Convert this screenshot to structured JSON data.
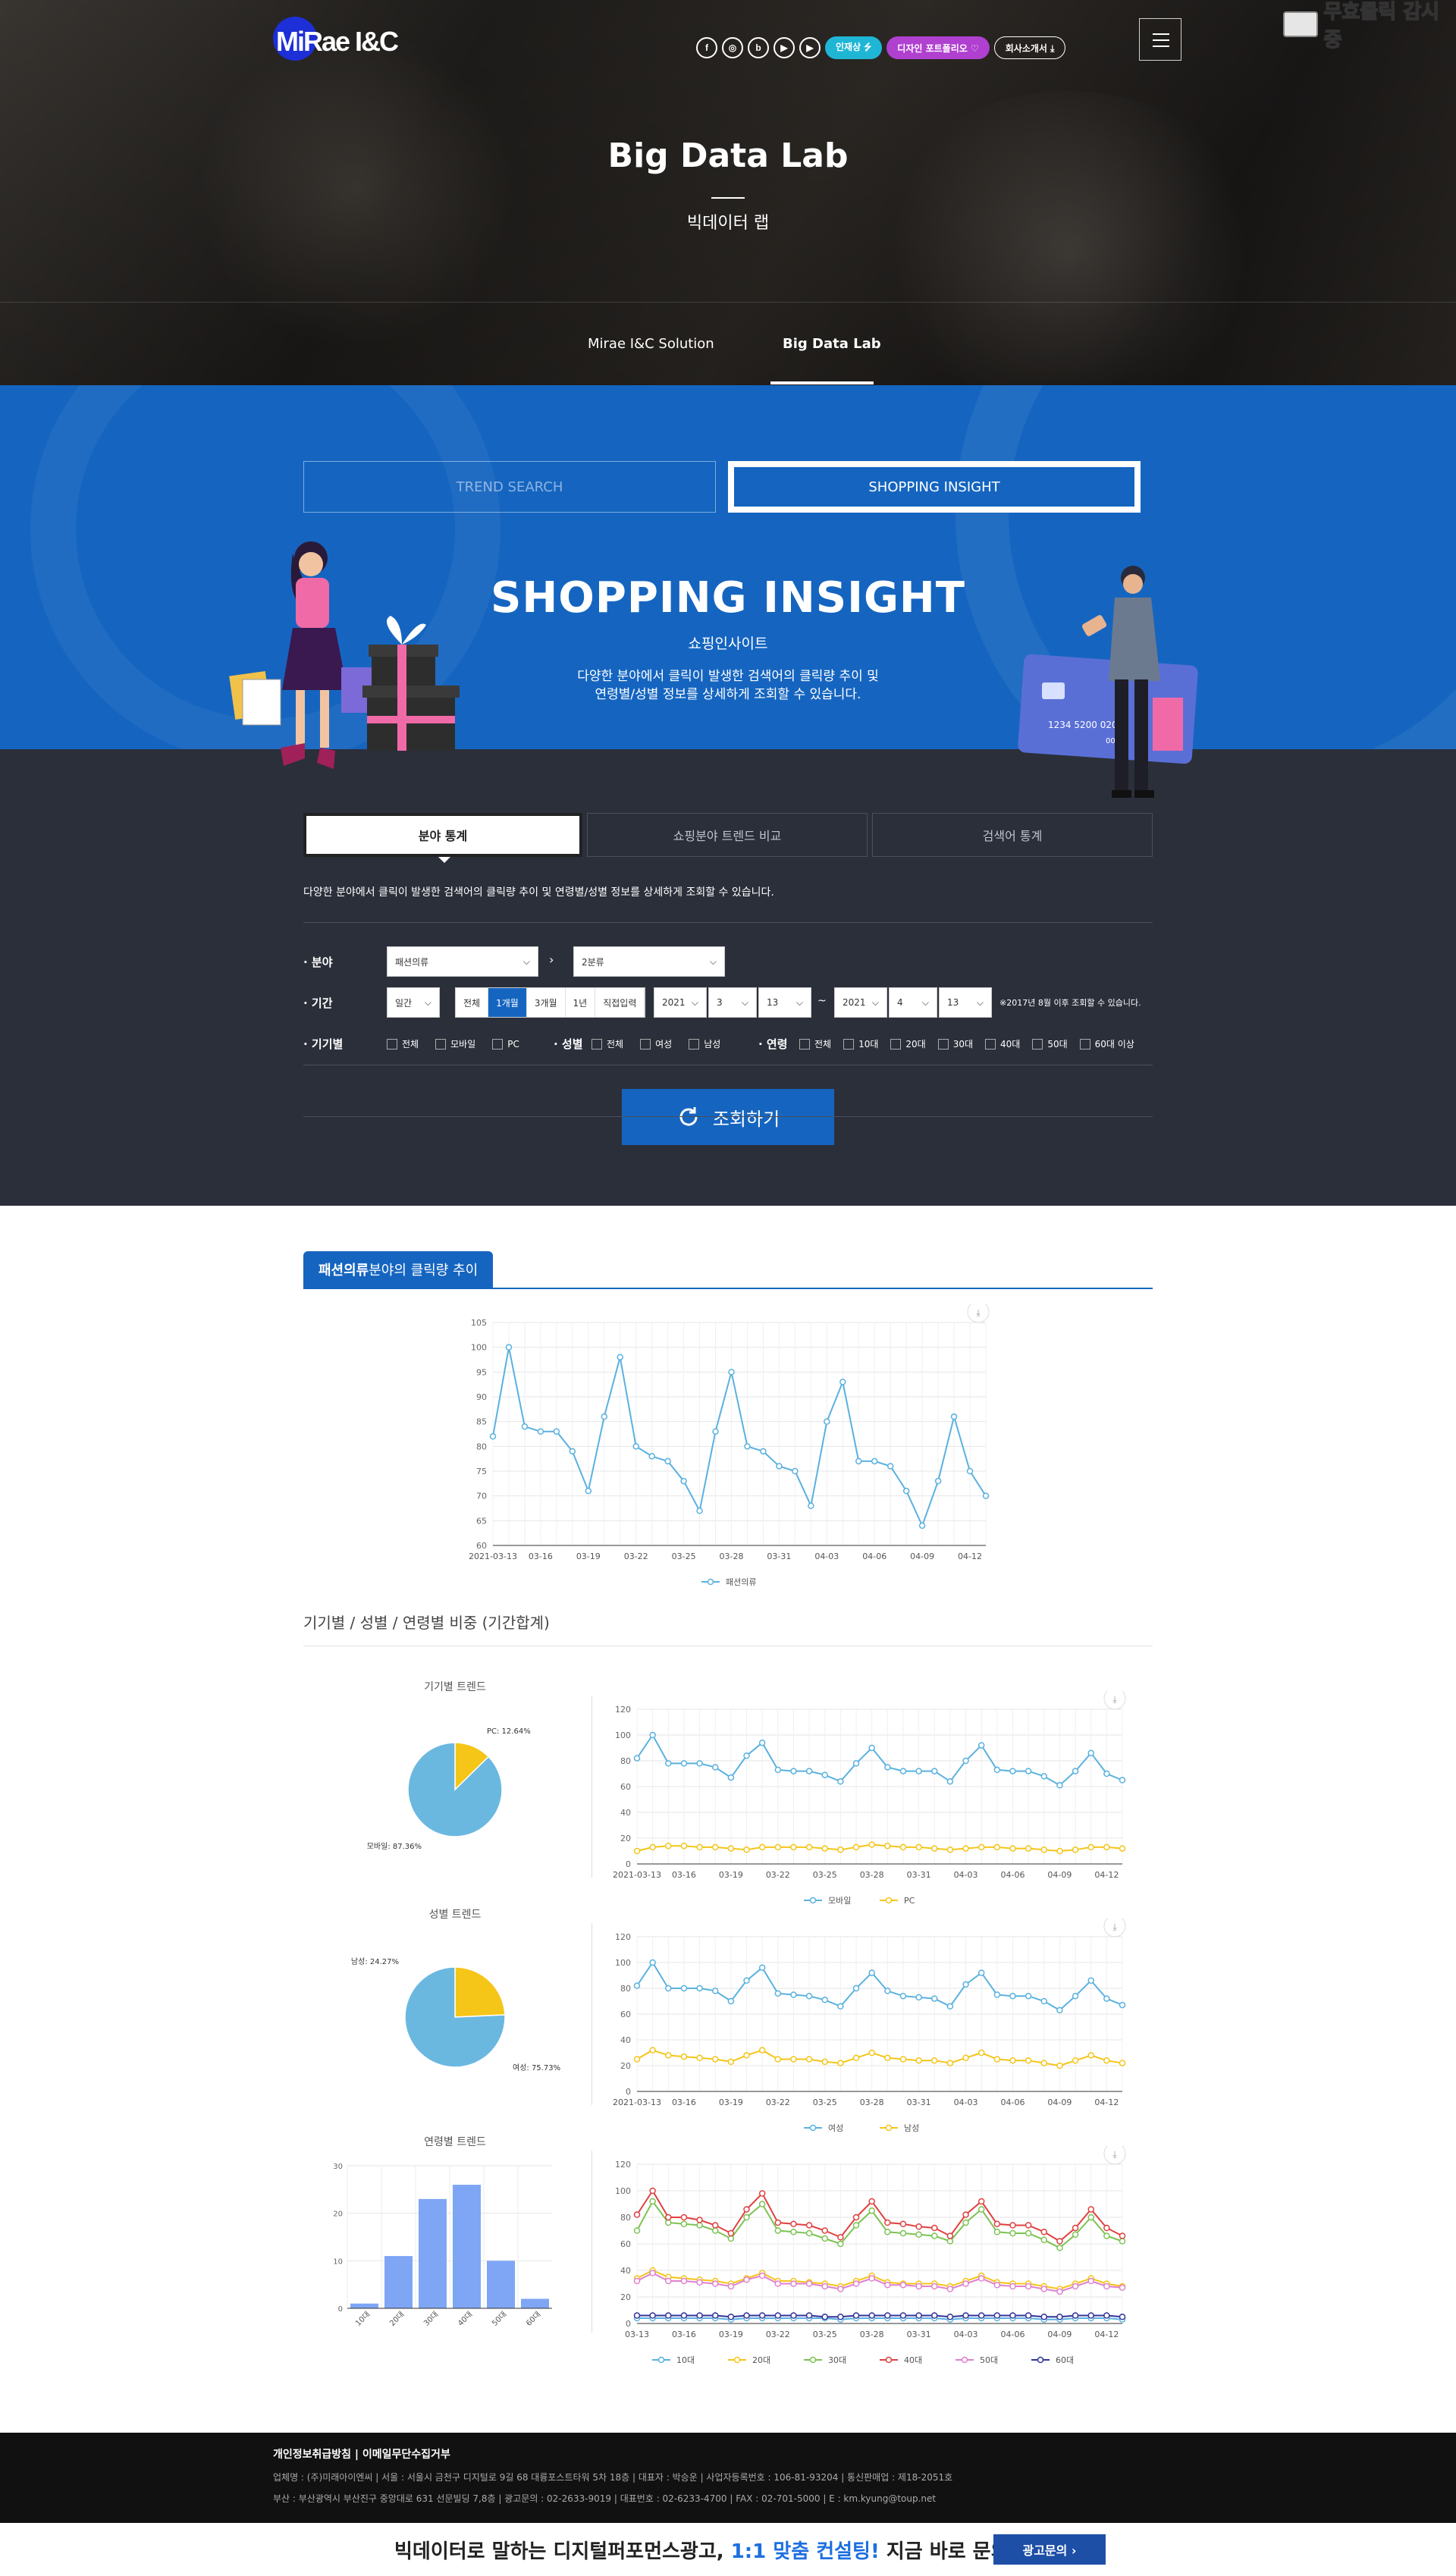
{
  "header": {
    "logo_text": "MiRae I&C",
    "social": [
      "f",
      "◎",
      "b",
      "▶",
      "▶"
    ],
    "social_names": [
      "facebook-icon",
      "instagram-icon",
      "blog-icon",
      "play-icon",
      "youtube-icon"
    ],
    "pills": [
      {
        "label": "인재상 ⭍",
        "color": "#1fb6d6"
      },
      {
        "label": "디자인 포트폴리오 ♡",
        "color": "#b040d0"
      },
      {
        "label": "회사소개서 ⤓",
        "color": "transparent"
      }
    ],
    "watch_label": "무효클릭 감시중"
  },
  "hero": {
    "title": "Big Data Lab",
    "subtitle": "빅데이터 랩",
    "subnav": [
      "Mirae I&C Solution",
      "Big Data Lab"
    ]
  },
  "top_tabs": [
    "TREND SEARCH",
    "SHOPPING INSIGHT"
  ],
  "insight": {
    "title": "SHOPPING INSIGHT",
    "subtitle": "쇼핑인사이트",
    "desc1": "다양한 분야에서 클릭이 발생한 검색어의 클릭량 추이 및",
    "desc2": "연령별/성별 정보를 상세하게 조회할 수 있습니다.",
    "card_number": "1234 5200 0201",
    "card_number2": "0020"
  },
  "sub_tabs": [
    "분야 통계",
    "쇼핑분야 트렌드 비교",
    "검색어 통계"
  ],
  "filter": {
    "desc": "다양한 분야에서 클릭이 발생한 검색어의 클릭량 추이 및 연령별/성별 정보를 상세하게 조회할 수 있습니다.",
    "field_label": "· 분야",
    "field1": "패션의류",
    "field2": "2분류",
    "period_label": "· 기간",
    "period_unit": "일간",
    "period_segments": [
      "전체",
      "1개월",
      "3개월",
      "1년",
      "직접입력"
    ],
    "from": [
      "2021",
      "3",
      "13"
    ],
    "tilde": "~",
    "to": [
      "2021",
      "4",
      "13"
    ],
    "period_note": "※2017년 8월 이후 조회할 수 있습니다.",
    "device_label": "· 기기별",
    "device_opts": [
      "전체",
      "모바일",
      "PC"
    ],
    "gender_label": "· 성별",
    "gender_opts": [
      "전체",
      "여성",
      "남성"
    ],
    "age_label": "· 연령",
    "age_opts": [
      "전체",
      "10대",
      "20대",
      "30대",
      "40대",
      "50대",
      "60대 이상"
    ],
    "search_btn": "조회하기"
  },
  "results": {
    "tab_bold": "패션의류",
    "tab_rest": " 분야의 클릭량 추이",
    "section2": "기기별 / 성별 / 연령별 비중 (기간합계)",
    "device_title": "기기별 트렌드",
    "gender_title": "성별 트렌드",
    "age_title": "연령별 트렌드"
  },
  "chart_data": [
    {
      "type": "line",
      "title": "",
      "x": [
        "2021-03-13",
        "03-14",
        "03-15",
        "03-16",
        "03-17",
        "03-18",
        "03-19",
        "03-20",
        "03-21",
        "03-22",
        "03-23",
        "03-24",
        "03-25",
        "03-26",
        "03-27",
        "03-28",
        "03-29",
        "03-30",
        "03-31",
        "04-01",
        "04-02",
        "04-03",
        "04-04",
        "04-05",
        "04-06",
        "04-07",
        "04-08",
        "04-09",
        "04-10",
        "04-11",
        "04-12",
        "04-13"
      ],
      "x_ticks": [
        "2021-03-13",
        "03-16",
        "03-19",
        "03-22",
        "03-25",
        "03-28",
        "03-31",
        "04-03",
        "04-06",
        "04-09",
        "04-12"
      ],
      "series": [
        {
          "name": "패션의류",
          "color": "#5ab1e0",
          "values": [
            82,
            100,
            84,
            83,
            83,
            79,
            71,
            86,
            98,
            80,
            78,
            77,
            73,
            67,
            83,
            95,
            80,
            79,
            76,
            75,
            68,
            85,
            93,
            77,
            77,
            76,
            71,
            64,
            73,
            86,
            75,
            70
          ]
        }
      ],
      "ylim": [
        60,
        105
      ],
      "yticks": [
        60,
        65,
        70,
        75,
        80,
        85,
        90,
        95,
        100,
        105
      ],
      "grid": true,
      "legend": "bottom"
    },
    {
      "type": "pie",
      "title": "기기별 트렌드",
      "labels": [
        "PC",
        "모바일"
      ],
      "label_text": [
        "PC: 12.64%",
        "모바일: 87.36%"
      ],
      "values": [
        12.64,
        87.36
      ],
      "colors": [
        "#f5c518",
        "#6ab8e0"
      ]
    },
    {
      "type": "line",
      "title": "",
      "x_ticks": [
        "2021-03-13",
        "03-16",
        "03-19",
        "03-22",
        "03-25",
        "03-28",
        "03-31",
        "04-03",
        "04-06",
        "04-09",
        "04-12"
      ],
      "series": [
        {
          "name": "모바일",
          "color": "#5ab1e0",
          "values": [
            82,
            100,
            78,
            78,
            78,
            75,
            67,
            84,
            94,
            73,
            72,
            72,
            69,
            64,
            78,
            90,
            75,
            72,
            72,
            72,
            64,
            80,
            92,
            73,
            72,
            72,
            68,
            61,
            72,
            86,
            70,
            65
          ]
        },
        {
          "name": "PC",
          "color": "#f5c518",
          "values": [
            10,
            13,
            14,
            14,
            13,
            13,
            12,
            11,
            13,
            13,
            13,
            13,
            12,
            11,
            13,
            15,
            14,
            13,
            13,
            12,
            11,
            12,
            13,
            13,
            12,
            12,
            11,
            10,
            11,
            13,
            13,
            12
          ]
        }
      ],
      "ylim": [
        0,
        120
      ],
      "yticks": [
        0,
        20,
        40,
        60,
        80,
        100,
        120
      ],
      "grid": true,
      "legend": "bottom"
    },
    {
      "type": "pie",
      "title": "성별 트렌드",
      "labels": [
        "남성",
        "여성"
      ],
      "label_text": [
        "남성: 24.27%",
        "여성: 75.73%"
      ],
      "values": [
        24.27,
        75.73
      ],
      "colors": [
        "#f5c518",
        "#6ab8e0"
      ]
    },
    {
      "type": "line",
      "title": "",
      "x_ticks": [
        "2021-03-13",
        "03-16",
        "03-19",
        "03-22",
        "03-25",
        "03-28",
        "03-31",
        "04-03",
        "04-06",
        "04-09",
        "04-12"
      ],
      "series": [
        {
          "name": "여성",
          "color": "#5ab1e0",
          "values": [
            82,
            100,
            80,
            80,
            80,
            78,
            70,
            86,
            96,
            76,
            75,
            74,
            71,
            66,
            80,
            92,
            78,
            74,
            73,
            72,
            66,
            83,
            92,
            75,
            74,
            74,
            70,
            63,
            74,
            86,
            72,
            67
          ]
        },
        {
          "name": "남성",
          "color": "#f5c518",
          "values": [
            25,
            32,
            28,
            27,
            26,
            25,
            23,
            28,
            32,
            25,
            25,
            25,
            23,
            22,
            26,
            30,
            26,
            25,
            24,
            24,
            22,
            26,
            30,
            25,
            24,
            24,
            22,
            20,
            24,
            28,
            24,
            22
          ]
        }
      ],
      "ylim": [
        0,
        120
      ],
      "yticks": [
        0,
        20,
        40,
        60,
        80,
        100,
        120
      ],
      "grid": true,
      "legend": "bottom"
    },
    {
      "type": "bar",
      "title": "연령별 트렌드",
      "categories": [
        "10대",
        "20대",
        "30대",
        "40대",
        "50대",
        "60대"
      ],
      "values": [
        1,
        11,
        23,
        26,
        10,
        2
      ],
      "color": "#7ea6f5",
      "ylim": [
        0,
        30
      ],
      "yticks": [
        0,
        10,
        20,
        30
      ]
    },
    {
      "type": "line",
      "title": "",
      "x_ticks": [
        "03-13",
        "03-16",
        "03-19",
        "03-22",
        "03-25",
        "03-28",
        "03-31",
        "04-03",
        "04-06",
        "04-09",
        "04-12"
      ],
      "series": [
        {
          "name": "10대",
          "color": "#5ab1e0",
          "values": [
            4,
            4,
            4,
            4,
            4,
            4,
            3,
            4,
            4,
            4,
            4,
            4,
            4,
            3,
            4,
            4,
            4,
            4,
            4,
            4,
            3,
            4,
            4,
            4,
            4,
            4,
            3,
            3,
            4,
            4,
            4,
            3
          ]
        },
        {
          "name": "20대",
          "color": "#f5c518",
          "values": [
            34,
            40,
            35,
            34,
            33,
            32,
            30,
            34,
            38,
            32,
            32,
            31,
            30,
            28,
            32,
            36,
            31,
            30,
            30,
            30,
            28,
            32,
            36,
            31,
            30,
            30,
            28,
            26,
            30,
            34,
            30,
            28
          ]
        },
        {
          "name": "30대",
          "color": "#7cc353",
          "values": [
            70,
            92,
            76,
            75,
            74,
            70,
            64,
            80,
            90,
            70,
            69,
            68,
            64,
            60,
            74,
            85,
            69,
            68,
            67,
            66,
            62,
            76,
            86,
            69,
            68,
            68,
            63,
            57,
            67,
            80,
            66,
            62
          ]
        },
        {
          "name": "40대",
          "color": "#e04040",
          "values": [
            82,
            100,
            80,
            80,
            78,
            74,
            68,
            86,
            98,
            76,
            75,
            74,
            70,
            65,
            80,
            92,
            76,
            75,
            73,
            72,
            66,
            82,
            92,
            75,
            74,
            74,
            69,
            62,
            72,
            86,
            72,
            66
          ]
        },
        {
          "name": "50대",
          "color": "#e080d0",
          "values": [
            32,
            38,
            32,
            32,
            31,
            30,
            28,
            33,
            36,
            30,
            30,
            30,
            28,
            26,
            30,
            34,
            29,
            29,
            28,
            28,
            26,
            30,
            34,
            29,
            28,
            28,
            26,
            24,
            28,
            32,
            28,
            27
          ]
        },
        {
          "name": "60대",
          "color": "#333399",
          "values": [
            6,
            6,
            6,
            6,
            6,
            6,
            5,
            6,
            6,
            6,
            6,
            6,
            5,
            5,
            6,
            6,
            6,
            6,
            6,
            6,
            5,
            6,
            6,
            6,
            6,
            6,
            5,
            5,
            6,
            6,
            6,
            5
          ]
        }
      ],
      "ylim": [
        0,
        120
      ],
      "yticks": [
        0,
        20,
        40,
        60,
        80,
        100,
        120
      ],
      "grid": true,
      "legend": "bottom"
    }
  ],
  "footer": {
    "links": "개인정보취급방침   |   이메일무단수집거부",
    "line1": "업체명 : (주)미래아이엔씨 | 서울 : 서울시 금천구 디지털로 9길 68 대륭포스트타워 5차 18층 | 대표자 : 박승운 | 사업자등록번호 : 106-81-93204 | 통신판매업 : 제18-2051호",
    "line2": "부산 : 부산광역시 부산진구 중앙대로 631 선문빌딩 7,8층 | 광고문의 : 02-2633-9019 | 대표번호 : 02-6233-4700 | FAX : 02-701-5000 | E : km.kyung@toup.net",
    "banner_a": "빅데이터로 말하는 디지털퍼포먼스광고, ",
    "banner_b": "1:1 맞춤 컨설팅!",
    "banner_c": " 지금 바로 문의하세요!",
    "banner_btn": "광고문의 ›"
  }
}
